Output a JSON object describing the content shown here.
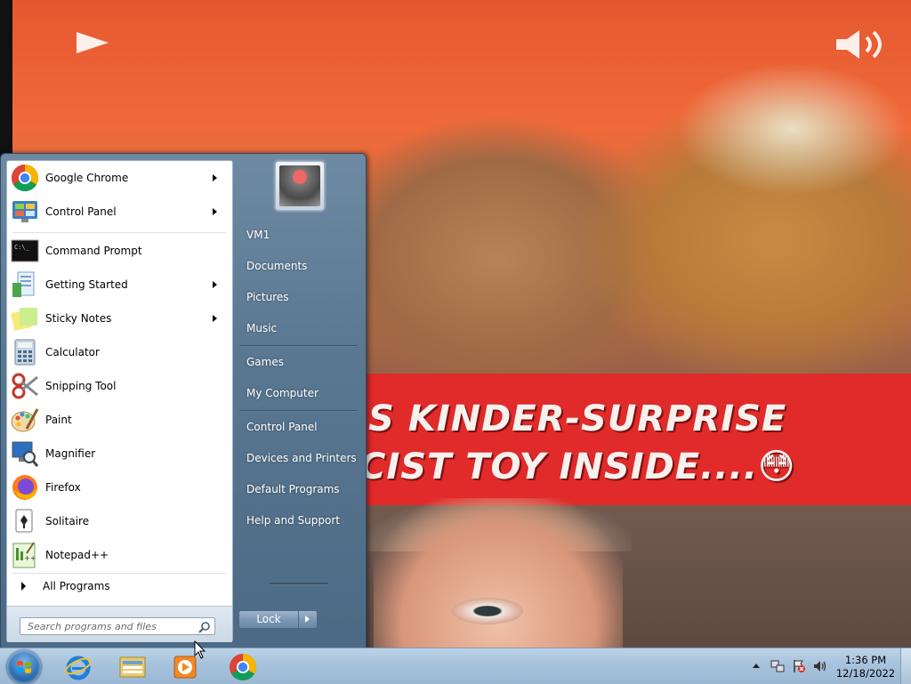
{
  "video": {
    "banner_line1": "S KINDER-SURPRISE",
    "banner_line2": "CIST TOY INSIDE....😳"
  },
  "start_menu": {
    "pinned": [
      {
        "label": "Google Chrome",
        "icon": "chrome-icon",
        "has_submenu": true
      },
      {
        "label": "Control Panel",
        "icon": "control-panel-icon",
        "has_submenu": true
      }
    ],
    "recent": [
      {
        "label": "Command Prompt",
        "icon": "cmd-icon",
        "has_submenu": false
      },
      {
        "label": "Getting Started",
        "icon": "getting-started-icon",
        "has_submenu": true
      },
      {
        "label": "Sticky Notes",
        "icon": "sticky-notes-icon",
        "has_submenu": true
      },
      {
        "label": "Calculator",
        "icon": "calculator-icon",
        "has_submenu": false
      },
      {
        "label": "Snipping Tool",
        "icon": "snipping-tool-icon",
        "has_submenu": false
      },
      {
        "label": "Paint",
        "icon": "paint-icon",
        "has_submenu": false
      },
      {
        "label": "Magnifier",
        "icon": "magnifier-icon",
        "has_submenu": false
      },
      {
        "label": "Firefox",
        "icon": "firefox-icon",
        "has_submenu": false
      },
      {
        "label": "Solitaire",
        "icon": "solitaire-icon",
        "has_submenu": false
      },
      {
        "label": "Notepad++",
        "icon": "notepad-plus-plus-icon",
        "has_submenu": false
      }
    ],
    "all_programs": "All Programs",
    "search_placeholder": "Search programs and files",
    "right_items": [
      "VM1",
      "Documents",
      "Pictures",
      "Music",
      "Games",
      "My Computer",
      "Control Panel",
      "Devices and Printers",
      "Default Programs",
      "Help and Support"
    ],
    "lock_label": "Lock"
  },
  "taskbar": {
    "pinned": [
      "internet-explorer-icon",
      "windows-explorer-icon",
      "media-player-icon",
      "chrome-icon"
    ],
    "time": "1:36 PM",
    "date": "12/18/2022"
  },
  "colors": {
    "banner_red": "#e12a2a",
    "start_menu_blue": "#5a7892",
    "taskbar_blue": "#a7c2dc"
  }
}
